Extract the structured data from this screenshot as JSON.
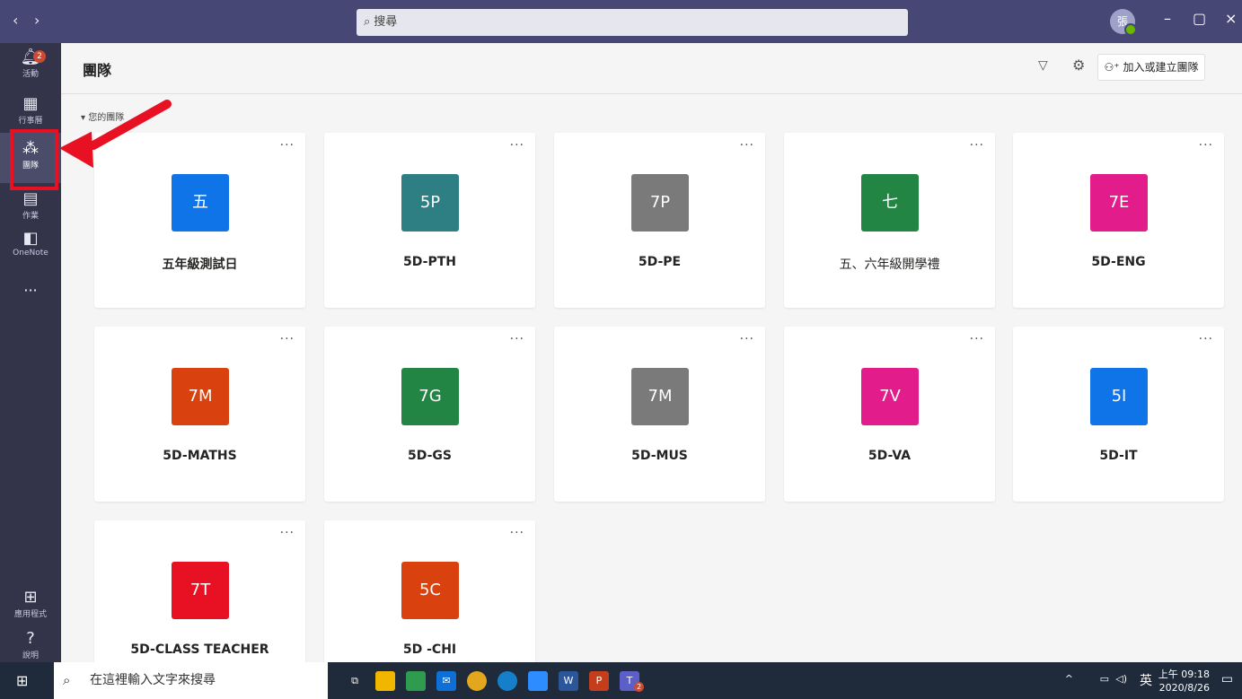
{
  "titlebar": {
    "back": "‹",
    "forward": "›",
    "search_placeholder": "搜尋",
    "avatar_text": "張",
    "minimize": "–",
    "maximize": "▢",
    "close": "×"
  },
  "rail": {
    "activity": {
      "label": "活動",
      "badge": "2"
    },
    "calendar": {
      "label": "行事曆"
    },
    "teams": {
      "label": "團隊"
    },
    "assignments": {
      "label": "作業"
    },
    "onenote": {
      "label": "OneNote"
    },
    "more": "···",
    "apps": {
      "label": "應用程式"
    },
    "help": {
      "label": "說明"
    }
  },
  "header": {
    "title": "團隊",
    "join_label": "加入或建立團隊"
  },
  "section_label": "您的團隊",
  "teams": [
    {
      "tile": "五",
      "name": "五年級測試日",
      "color": "#0f74e8"
    },
    {
      "tile": "5P",
      "name": "5D-PTH",
      "color": "#2d7f83"
    },
    {
      "tile": "7P",
      "name": "5D-PE",
      "color": "#7a7a7a"
    },
    {
      "tile": "七",
      "name": "五、六年級開學禮",
      "color": "#238544"
    },
    {
      "tile": "7E",
      "name": "5D-ENG",
      "color": "#e31c8c"
    },
    {
      "tile": "7M",
      "name": "5D-MATHS",
      "color": "#d9410f"
    },
    {
      "tile": "7G",
      "name": "5D-GS",
      "color": "#238544"
    },
    {
      "tile": "7M",
      "name": "5D-MUS",
      "color": "#7a7a7a"
    },
    {
      "tile": "7V",
      "name": "5D-VA",
      "color": "#e31c8c"
    },
    {
      "tile": "5I",
      "name": "5D-IT",
      "color": "#0f74e8"
    },
    {
      "tile": "7T",
      "name": "5D-CLASS TEACHER",
      "color": "#e81123"
    },
    {
      "tile": "5C",
      "name": "5D -CHI",
      "color": "#d9410f"
    }
  ],
  "taskbar": {
    "search_placeholder": "在這裡輸入文字來搜尋",
    "ime": "英",
    "time": "上午 09:18",
    "date": "2020/8/26",
    "teams_badge": "2"
  }
}
